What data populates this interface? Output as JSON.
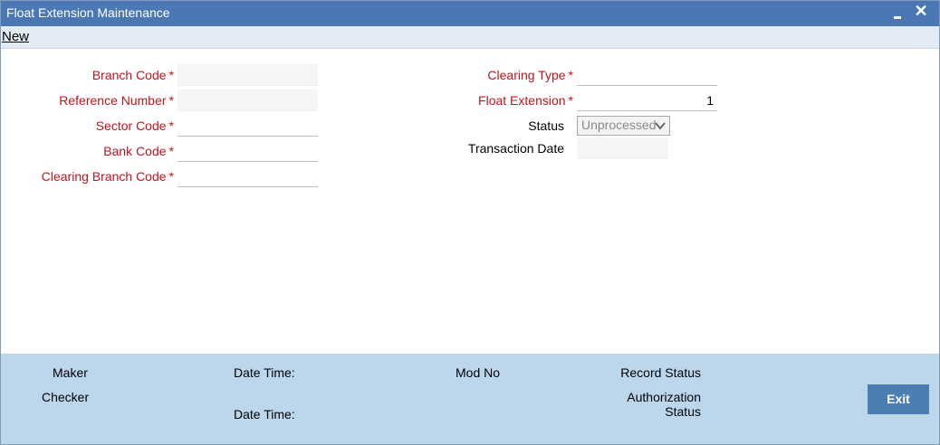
{
  "window": {
    "title": "Float Extension Maintenance"
  },
  "menu": {
    "new_label": "New"
  },
  "form": {
    "branch_code": {
      "label": "Branch Code",
      "required": "*",
      "value": ""
    },
    "reference_number": {
      "label": "Reference Number",
      "required": "*",
      "value": ""
    },
    "sector_code": {
      "label": "Sector Code",
      "required": "*",
      "value": ""
    },
    "bank_code": {
      "label": "Bank Code",
      "required": "*",
      "value": ""
    },
    "clearing_branch_code": {
      "label": "Clearing Branch Code",
      "required": "*",
      "value": ""
    },
    "clearing_type": {
      "label": "Clearing Type",
      "required": "*",
      "value": ""
    },
    "float_extension": {
      "label": "Float Extension",
      "required": "*",
      "value": "1"
    },
    "status": {
      "label": "Status",
      "value": "Unprocessed"
    },
    "transaction_date": {
      "label": "Transaction Date",
      "value": ""
    }
  },
  "footer": {
    "maker": "Maker",
    "checker": "Checker",
    "date_time_1": "Date Time:",
    "date_time_2": "Date Time:",
    "mod_no": "Mod No",
    "record_status": "Record Status",
    "authorization": "Authorization",
    "authorization_status": "Status",
    "exit_label": "Exit"
  },
  "colors": {
    "titlebar": "#4b78b5",
    "footer": "#bcd6ec",
    "required_label": "#c0141e",
    "exit_button": "#4b7fb4"
  },
  "icons": {
    "minimize": "minimize-icon",
    "close": "close-icon",
    "dropdown": "chevron-down-icon"
  }
}
